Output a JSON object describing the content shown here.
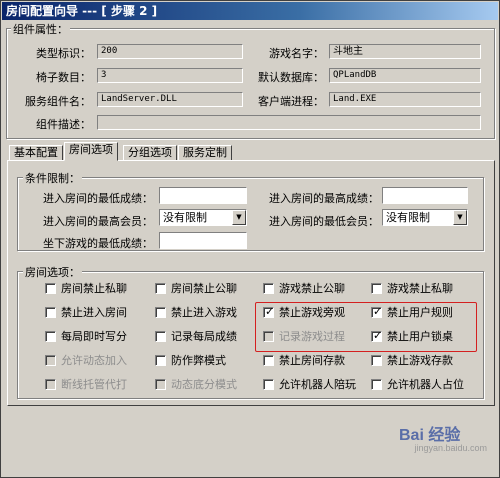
{
  "window": {
    "title": "房间配置向导 --- [ 步骤 2 ]"
  },
  "component_group": {
    "legend": "组件属性：",
    "type_id_label": "类型标识：",
    "type_id_value": "200",
    "game_name_label": "游戏名字：",
    "game_name_value": "斗地主",
    "chair_count_label": "椅子数目：",
    "chair_count_value": "3",
    "default_db_label": "默认数据库：",
    "default_db_value": "QPLandDB",
    "service_component_label": "服务组件名：",
    "service_component_value": "LandServer.DLL",
    "client_process_label": "客户端进程：",
    "client_process_value": "Land.EXE",
    "component_desc_label": "组件描述：",
    "component_desc_value": ""
  },
  "tabs": [
    {
      "label": "基本配置",
      "active": false
    },
    {
      "label": "房间选项",
      "active": true
    },
    {
      "label": "分组选项",
      "active": false
    },
    {
      "label": "服务定制",
      "active": false
    }
  ],
  "conditions": {
    "legend": "条件限制：",
    "min_score_label": "进入房间的最低成绩：",
    "min_score_value": "",
    "max_score_label": "进入房间的最高成绩：",
    "max_score_value": "",
    "max_member_label": "进入房间的最高会员：",
    "max_member_value": "没有限制",
    "min_member_label": "进入房间的最低会员：",
    "min_member_value": "没有限制",
    "sit_min_score_label": "坐下游戏的最低成绩：",
    "sit_min_score_value": ""
  },
  "room_options": {
    "legend": "房间选项：",
    "rows": [
      [
        {
          "label": "房间禁止私聊",
          "checked": false,
          "disabled": false
        },
        {
          "label": "房间禁止公聊",
          "checked": false,
          "disabled": false
        },
        {
          "label": "游戏禁止公聊",
          "checked": false,
          "disabled": false
        },
        {
          "label": "游戏禁止私聊",
          "checked": false,
          "disabled": false
        }
      ],
      [
        {
          "label": "禁止进入房间",
          "checked": false,
          "disabled": false
        },
        {
          "label": "禁止进入游戏",
          "checked": false,
          "disabled": false
        },
        {
          "label": "禁止游戏旁观",
          "checked": true,
          "disabled": false
        },
        {
          "label": "禁止用户规则",
          "checked": true,
          "disabled": false
        }
      ],
      [
        {
          "label": "每局即时写分",
          "checked": false,
          "disabled": false
        },
        {
          "label": "记录每局成绩",
          "checked": false,
          "disabled": false
        },
        {
          "label": "记录游戏过程",
          "checked": false,
          "disabled": true
        },
        {
          "label": "禁止用户锁桌",
          "checked": true,
          "disabled": false
        }
      ],
      [
        {
          "label": "允许动态加入",
          "checked": false,
          "disabled": true
        },
        {
          "label": "防作弊模式",
          "checked": false,
          "disabled": false
        },
        {
          "label": "禁止房间存款",
          "checked": false,
          "disabled": false
        },
        {
          "label": "禁止游戏存款",
          "checked": false,
          "disabled": false
        }
      ],
      [
        {
          "label": "断线托管代打",
          "checked": false,
          "disabled": true
        },
        {
          "label": "动态底分模式",
          "checked": false,
          "disabled": true
        },
        {
          "label": "允许机器人陪玩",
          "checked": false,
          "disabled": false
        },
        {
          "label": "允许机器人占位",
          "checked": false,
          "disabled": false
        }
      ]
    ]
  },
  "watermark": {
    "main": "Bai 经验",
    "sub": "jingyan.baidu.com"
  },
  "colors": {
    "highlight_box": "#d42020",
    "title_start": "#0a246a"
  }
}
